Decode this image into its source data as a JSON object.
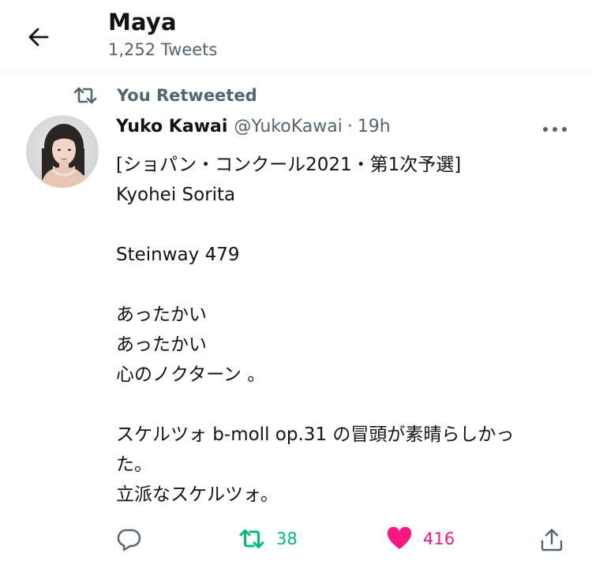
{
  "header": {
    "title": "Maya",
    "subtitle": "1,252 Tweets"
  },
  "retweet": {
    "label": "You Retweeted"
  },
  "tweet": {
    "display_name": "Yuko Kawai",
    "handle": "@YukoKawai",
    "separator": "·",
    "time": "19h",
    "lines": [
      "[ショパン・コンクール2021・第1次予選]",
      "Kyohei Sorita",
      "",
      "Steinway 479",
      "",
      "あったかい",
      "あったかい",
      "心のノクターン 。",
      "",
      "スケルツォ b-moll op.31 の冒頭が素晴らしかっ",
      "た。",
      "立派なスケルツォ。"
    ]
  },
  "actions": {
    "retweet_count": "38",
    "like_count": "416"
  },
  "colors": {
    "text": "#0f1419",
    "secondary": "#536471",
    "retweet_green": "#00ba7c",
    "like_pink": "#f91880",
    "divider": "#eff3f4"
  },
  "icons": {
    "back": "arrow-left-icon",
    "retweet_indicator": "retweet-icon",
    "more": "more-horizontal-icon",
    "reply": "reply-icon",
    "retweet": "retweet-icon",
    "like": "heart-icon",
    "share": "share-icon"
  }
}
